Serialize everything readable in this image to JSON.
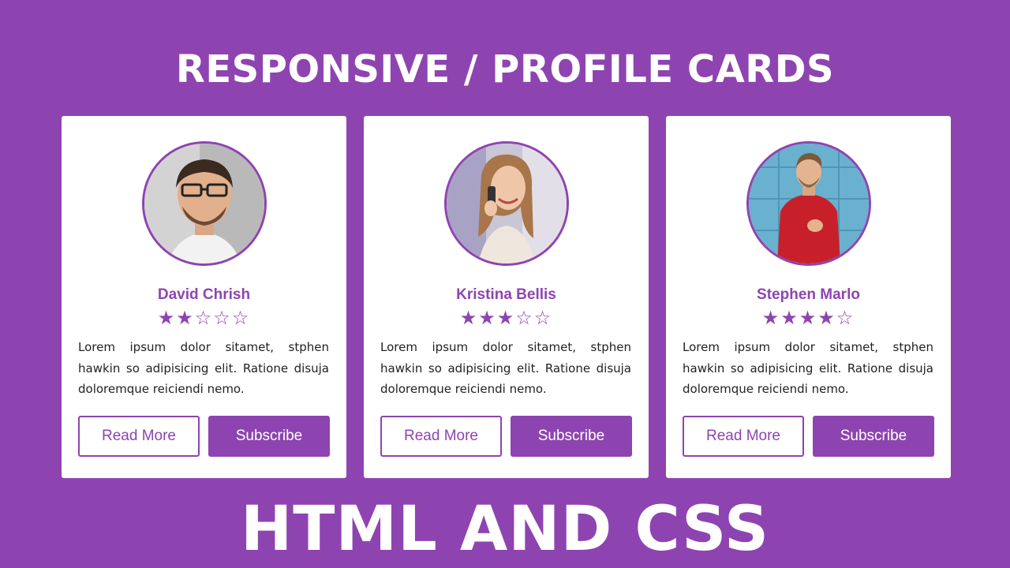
{
  "heading": "RESPONSIVE / PROFILE CARDS",
  "footer": "HTML AND CSS",
  "colors": {
    "accent": "#8e44b0",
    "background": "#8e44b0",
    "card": "#ffffff"
  },
  "cards": [
    {
      "name": "David Chrish",
      "rating": 2,
      "max_rating": 5,
      "description": "Lorem ipsum dolor sitamet, stphen hawkin so adipisicing elit. Ratione disuja doloremque reiciendi nemo.",
      "read_more": "Read More",
      "subscribe": "Subscribe",
      "avatar_icon": "man-glasses-avatar"
    },
    {
      "name": "Kristina Bellis",
      "rating": 3,
      "max_rating": 5,
      "description": "Lorem ipsum dolor sitamet, stphen hawkin so adipisicing elit. Ratione disuja doloremque reiciendi nemo.",
      "read_more": "Read More",
      "subscribe": "Subscribe",
      "avatar_icon": "woman-phone-avatar"
    },
    {
      "name": "Stephen Marlo",
      "rating": 4,
      "max_rating": 5,
      "description": "Lorem ipsum dolor sitamet, stphen hawkin so adipisicing elit. Ratione disuja doloremque reiciendi nemo.",
      "read_more": "Read More",
      "subscribe": "Subscribe",
      "avatar_icon": "man-red-sweater-avatar"
    }
  ]
}
